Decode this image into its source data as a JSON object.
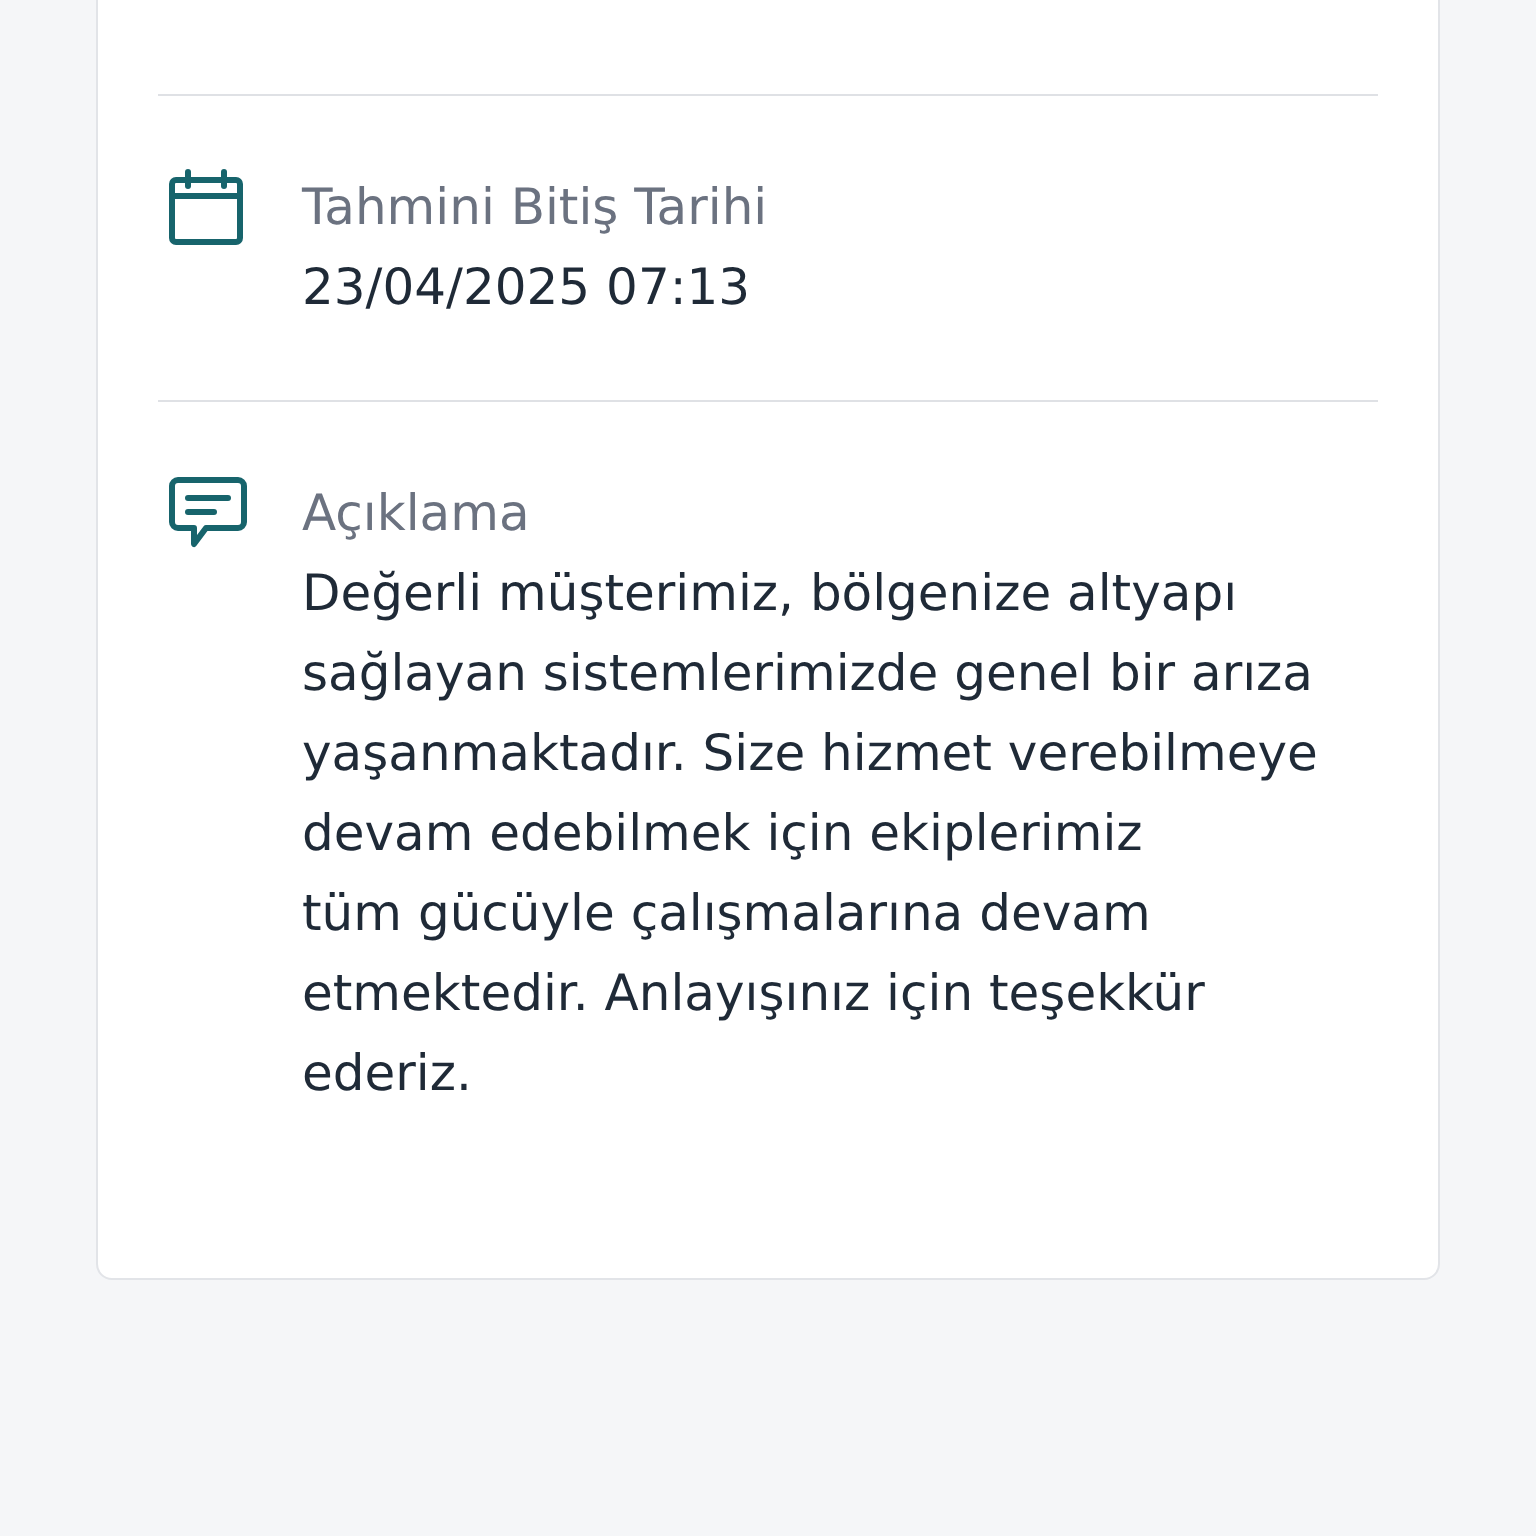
{
  "details": [
    {
      "kind": "date",
      "label": "Tahmini Bitiş Tarihi",
      "value": "23/04/2025 07:13"
    },
    {
      "kind": "note",
      "label": "Açıklama",
      "value": "Değerli müşterimiz, bölgenize altyapı sağlayan sistemlerimizde genel bir arıza yaşanmaktadır. Size hizmet verebilmeye devam edebilmek için ekiplerimiz\ntüm gücüyle çalışmalarına devam etmektedir. Anlayışınız için teşekkür ederiz."
    }
  ]
}
